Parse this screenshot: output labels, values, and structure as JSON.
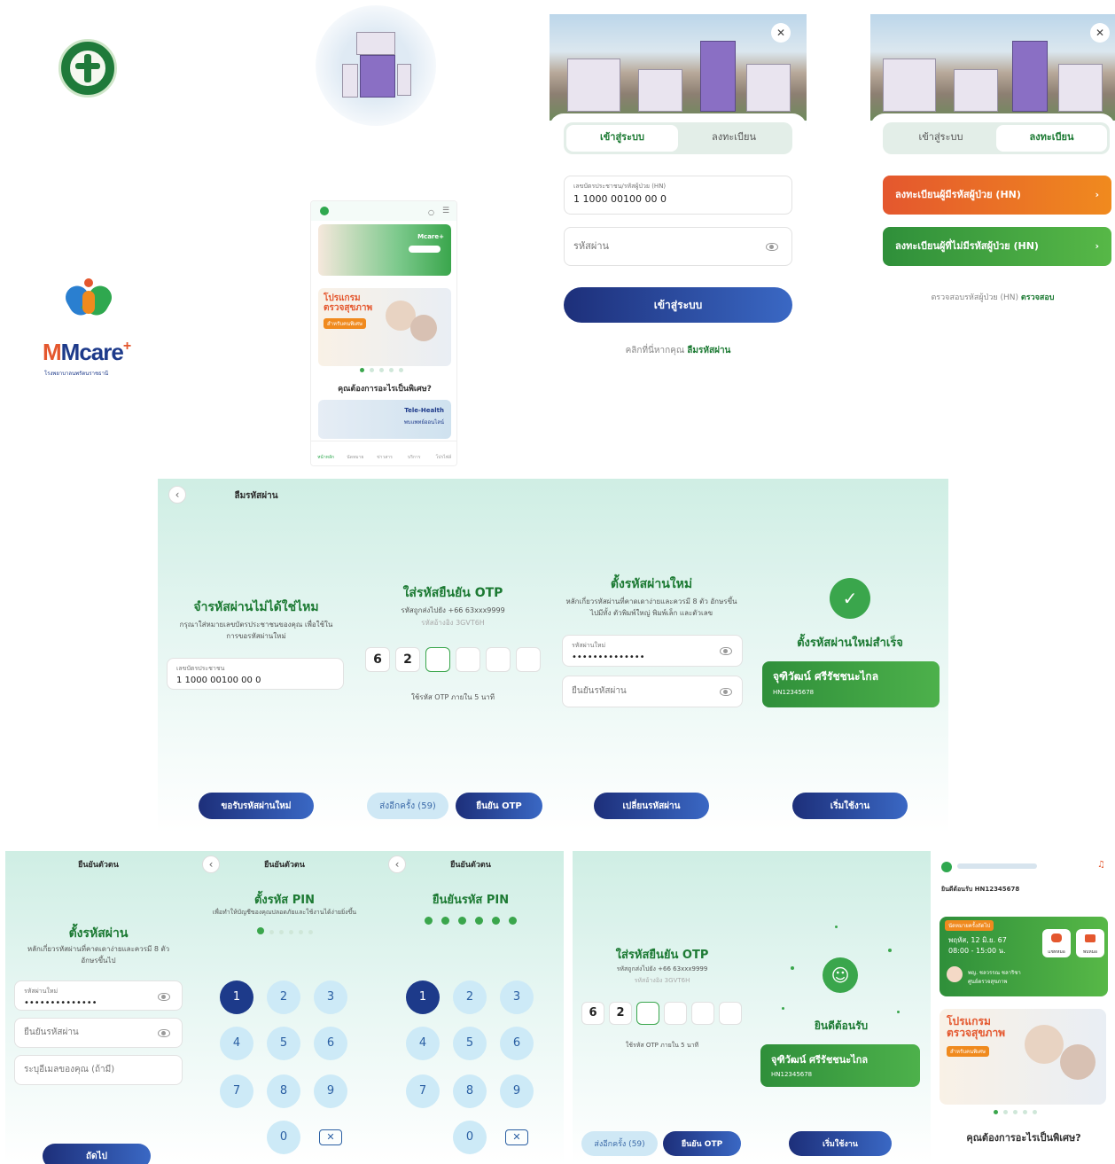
{
  "splash": {
    "brand": "Mcare",
    "brand_plus": "+",
    "brand_sub": "โรงพยาบาลนพรัตนราชธานี"
  },
  "home": {
    "banner_brand": "Mcare+",
    "promo_title": "โปรแกรม ตรวจสุขภาพ",
    "promo_badge": "สำหรับคนพิเศษ",
    "question": "คุณต้องการอะไรเป็นพิเศษ?",
    "tele_title": "Tele-Health",
    "tele_sub": "พบแพทย์ออนไลน์",
    "nav": [
      "หน้าหลัก",
      "นัดหมาย",
      "ข่าวสาร",
      "บริการ",
      "โปรไฟล์"
    ]
  },
  "login": {
    "tab_login": "เข้าสู่ระบบ",
    "tab_register": "ลงทะเบียน",
    "id_label": "เลขบัตรประชาชน/รหัสผู้ป่วย (HN)",
    "id_value": "1 1000 00100 00 0",
    "password_placeholder": "รหัสผ่าน",
    "login_button": "เข้าสู่ระบบ",
    "forgot_prefix": "คลิกที่นี่หากคุณ",
    "forgot_link": "ลืมรหัสผ่าน"
  },
  "register": {
    "tab_login": "เข้าสู่ระบบ",
    "tab_register": "ลงทะเบียน",
    "with_hn": "ลงทะเบียนผู้มีรหัสผู้ป่วย (HN)",
    "without_hn": "ลงทะเบียนผู้ที่ไม่มีรหัสผู้ป่วย (HN)",
    "check_prefix": "ตรวจสอบรหัสผู้ป่วย (HN)",
    "check_link": "ตรวจสอบ"
  },
  "forgot": {
    "header": "ลืมรหัสผ่าน",
    "title": "จำรหัสผ่านไม่ได้ใช่ไหม",
    "desc": "กรุณาใส่หมายเลขบัตรประชาชนของคุณ เพื่อใช้ในการขอรหัสผ่านใหม่",
    "id_label": "เลขบัตรประชาชน",
    "id_value": "1 1000 00100 00 0",
    "button": "ขอรับรหัสผ่านใหม่"
  },
  "otp": {
    "title": "ใส่รหัสยืนยัน OTP",
    "desc": "รหัสถูกส่งไปยัง +66 63xxx9999",
    "ref": "รหัสอ้างอิง 3GVT6H",
    "digits": [
      "6",
      "2",
      "",
      "",
      "",
      ""
    ],
    "expire": "ใช้รหัส OTP ภายใน 5 นาที",
    "resend": "ส่งอีกครั้ง (59)",
    "confirm": "ยืนยัน OTP"
  },
  "newpass": {
    "title": "ตั้งรหัสผ่านใหม่",
    "desc": "หลักเกี่ยวรหัสผ่านที่คาดเดาง่ายและควรมี 8 ตัว อักษรขึ้นไปมีทั้ง ตัวพิมพ์ใหญ่ พิมพ์เล็ก และตัวเลข",
    "new_label": "รหัสผ่านใหม่",
    "new_value": "••••••••••••••",
    "confirm_placeholder": "ยืนยันรหัสผ่าน",
    "button": "เปลี่ยนรหัสผ่าน"
  },
  "success": {
    "title": "ตั้งรหัสผ่านใหม่สำเร็จ",
    "name": "จุฑิวัฒน์ ศรีรัชชนะไกล",
    "hn": "HN12345678",
    "button": "เริ่มใช้งาน"
  },
  "setpass": {
    "header": "ยืนยันตัวตน",
    "title": "ตั้งรหัสผ่าน",
    "desc": "หลักเกี่ยวรหัสผ่านที่คาดเดาง่ายและควรมี 8 ตัวอักษรขึ้นไป",
    "pass_label": "รหัสผ่านใหม่",
    "pass_value": "••••••••••••••",
    "confirm_placeholder": "ยืนยันรหัสผ่าน",
    "email_placeholder": "ระบุอีเมลของคุณ (ถ้ามี)",
    "button": "ถัดไป"
  },
  "pin1": {
    "header": "ยืนยันตัวตน",
    "title": "ตั้งรหัส PIN",
    "desc": "เพื่อทำให้บัญชีของคุณปลอดภัยและใช้งานได้ง่ายยิ่งขึ้น",
    "keys": [
      "1",
      "2",
      "3",
      "4",
      "5",
      "6",
      "7",
      "8",
      "9",
      "0"
    ]
  },
  "pin2": {
    "header": "ยืนยันตัวตน",
    "title": "ยืนยันรหัส PIN",
    "keys": [
      "1",
      "2",
      "3",
      "4",
      "5",
      "6",
      "7",
      "8",
      "9",
      "0"
    ]
  },
  "otp2": {
    "title": "ใส่รหัสยืนยัน OTP",
    "desc": "รหัสถูกส่งไปยัง +66 63xxx9999",
    "ref": "รหัสอ้างอิง 3GVT6H",
    "digits": [
      "6",
      "2",
      "",
      "",
      "",
      ""
    ],
    "expire": "ใช้รหัส OTP ภายใน 5 นาที",
    "resend": "ส่งอีกครั้ง (59)",
    "confirm": "ยืนยัน OTP"
  },
  "welcome": {
    "title": "ยินดีต้อนรับ",
    "name": "จุฑิวัฒน์ ศรีรัชชนะไกล",
    "hn": "HN12345678",
    "button": "เริ่มใช้งาน"
  },
  "dash": {
    "greeting": "ยินดีต้อนรับ HN12345678",
    "appt_badge": "นัดหมายครั้งถัดไป",
    "appt_date": "พฤหัส, 12 มิ.ย. 67",
    "appt_time": "08:00 - 15:00 น.",
    "doctor": "พญ. ชลวรรณ ชลาริชา",
    "dept": "ศูนย์ตรวจสุขภาพ",
    "chat": "แชทหมอ",
    "video": "พบหมอ",
    "promo_title": "โปรแกรม ตรวจสุขภาพ",
    "promo_badge": "สำหรับคนพิเศษ",
    "question": "คุณต้องการอะไรเป็นพิเศษ?"
  }
}
